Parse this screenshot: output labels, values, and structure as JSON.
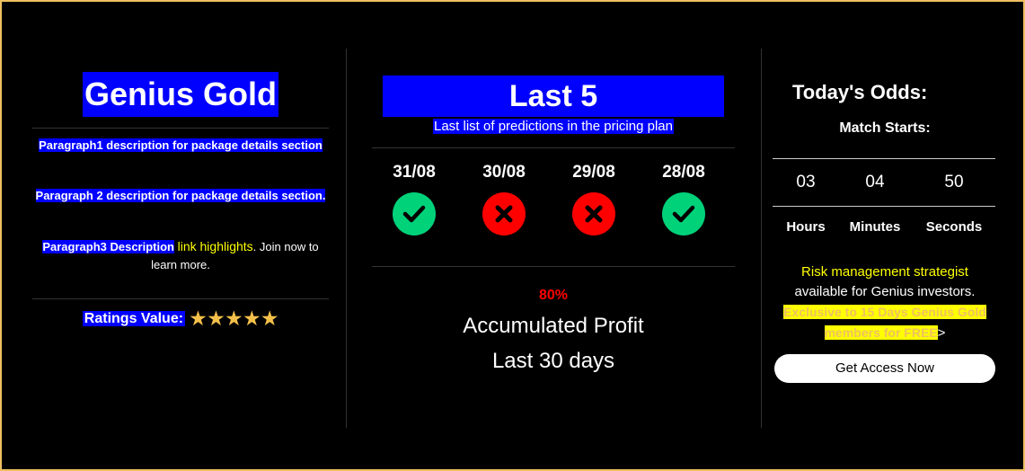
{
  "plan": {
    "title": "Genius Gold",
    "para1": "Paragraph1 description for package details section",
    "para2": "Paragraph 2 description for package details section.",
    "para3_main": "Paragraph3 Description",
    "para3_link": "link highlights",
    "para3_tail": ". Join now to learn more.",
    "ratings_label": "Ratings Value:",
    "rating_stars": 5
  },
  "last5": {
    "title": "Last 5",
    "subtitle": "Last list of predictions in the pricing plan",
    "predictions": [
      {
        "date": "31/08",
        "result": "win"
      },
      {
        "date": "30/08",
        "result": "loss"
      },
      {
        "date": "29/08",
        "result": "loss"
      },
      {
        "date": "28/08",
        "result": "win"
      }
    ],
    "percent": "80%",
    "acc_line1": "Accumulated Profit",
    "acc_line2": "Last 30 days"
  },
  "odds": {
    "title": "Today's Odds:",
    "match_starts": "Match Starts:",
    "hours": "03",
    "minutes": "04",
    "seconds": "50",
    "hours_label": "Hours",
    "minutes_label": "Minutes",
    "seconds_label": "Seconds",
    "risk_line1": "Risk management strategist",
    "risk_line2": "available for Genius investors.",
    "exclusive": "Exclusive to 15 Days Genius Gold members for FREE",
    "arrow": ">",
    "cta_label": "Get Access Now"
  },
  "colors": {
    "background": "#000000",
    "highlight": "#0000ff",
    "win": "#00d27a",
    "loss": "#ff0000",
    "yellow": "#ffff00",
    "star": "#f5c04a",
    "frame": "#f0c060"
  },
  "icons": {
    "win": "check-icon",
    "loss": "x-icon",
    "rating": "star-icon"
  }
}
